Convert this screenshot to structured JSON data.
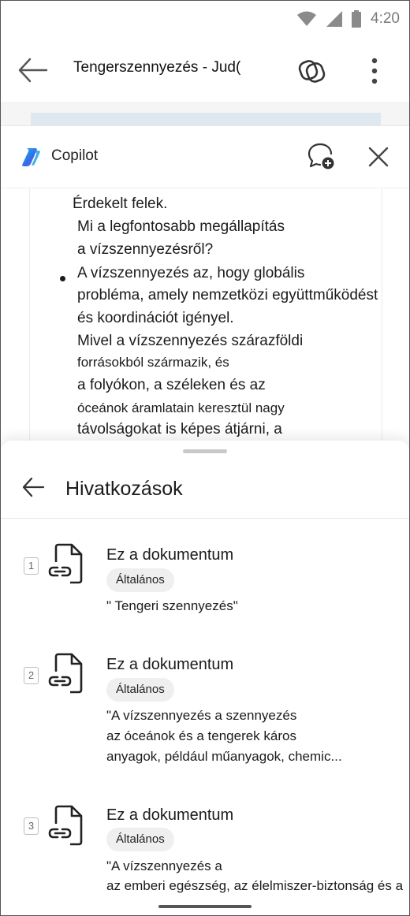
{
  "status_bar": {
    "time": "4:20"
  },
  "app_bar": {
    "title": "Tengerszennyezés - Jud("
  },
  "copilot": {
    "title": "Copilot",
    "body_lines": [
      "Érdekelt felek.",
      "Mi a legfontosabb megállapítás",
      "a vízszennyezésről?",
      "A vízszennyezés az, hogy globális",
      "probléma, amely nemzetközi együttműködést",
      "és koordinációt igényel.",
      "Mivel a vízszennyezés szárazföldi",
      "forrásokból származik, és",
      "a folyókon, a széleken és az",
      "óceánok áramlatain keresztül nagy",
      "távolságokat is képes átjárni, a"
    ]
  },
  "references": {
    "title": "Hivatkozások",
    "items": [
      {
        "number": "1",
        "name": "Ez a dokumentum",
        "tag": "Általános",
        "snippet": [
          "\" Tengeri szennyezés\""
        ]
      },
      {
        "number": "2",
        "name": "Ez a dokumentum",
        "tag": "Általános",
        "snippet": [
          "\"A vízszennyezés a szennyezés",
          "az óceánok és a tengerek káros",
          "anyagok, például műanyagok, chemic..."
        ]
      },
      {
        "number": "3",
        "name": "Ez a dokumentum",
        "tag": "Általános",
        "snippet": [
          "\"A vízszennyezés a",
          "az emberi egészség, az élelmiszer-biztonság és a"
        ]
      }
    ]
  },
  "icons": {
    "wifi": "wifi-icon",
    "signal": "signal-icon",
    "battery": "battery-icon",
    "back": "back-arrow-icon",
    "loop": "loop-icon",
    "more": "more-vertical-icon",
    "copilot": "copilot-logo-icon",
    "new_chat": "new-chat-icon",
    "close": "close-icon",
    "document_link": "document-link-icon"
  },
  "colors": {
    "accent_blue": "#2f6fe8",
    "doc_highlight": "#dfe7ef"
  }
}
